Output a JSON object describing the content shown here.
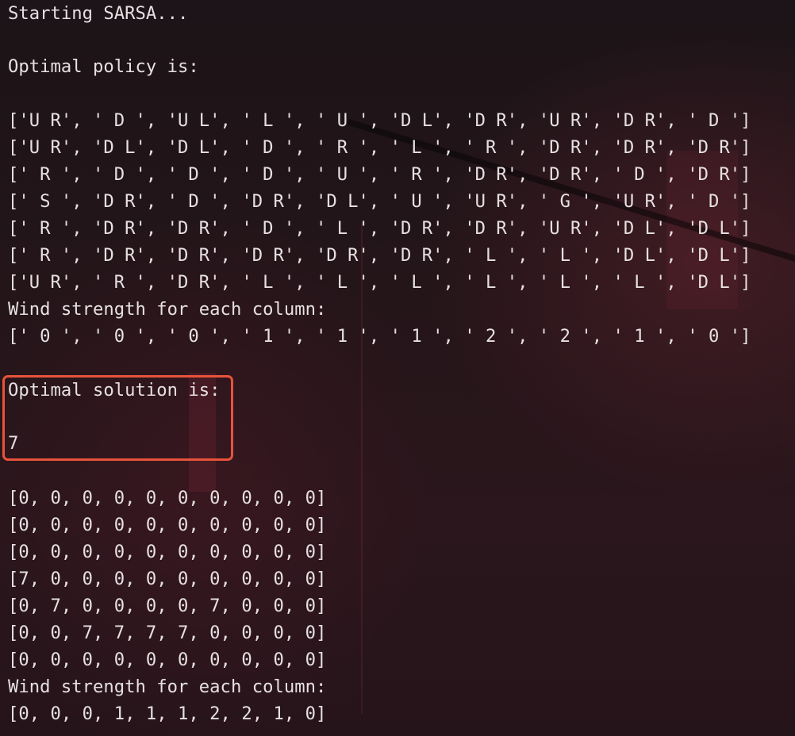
{
  "header": {
    "start_message": "Starting SARSA...",
    "policy_heading": "Optimal policy is:"
  },
  "policy_grid": [
    "['U R', ' D ', 'U L', ' L ', ' U ', 'D L', 'D R', 'U R', 'D R', ' D ']",
    "['U R', 'D L', 'D L', ' D ', ' R ', ' L ', ' R ', 'D R', 'D R', 'D R']",
    "[' R ', ' D ', ' D ', ' D ', ' U ', ' R ', 'D R', 'D R', ' D ', 'D R']",
    "[' S ', 'D R', ' D ', 'D R', 'D L', ' U ', 'U R', ' G ', 'U R', ' D ']",
    "[' R ', 'D R', 'D R', ' D ', ' L ', 'D R', 'D R', 'U R', 'D L', 'D L']",
    "[' R ', 'D R', 'D R', 'D R', 'D R', 'D R', ' L ', ' L ', 'D L', 'D L']",
    "['U R', ' R ', 'D R', ' L ', ' L ', ' L ', ' L ', ' L ', ' L ', 'D L']"
  ],
  "policy_wind": {
    "heading": "Wind strength for each column:",
    "values": "[' 0 ', ' 0 ', ' 0 ', ' 1 ', ' 1 ', ' 1 ', ' 2 ', ' 2 ', ' 1 ', ' 0 ']"
  },
  "solution": {
    "heading": "Optimal solution is:",
    "value": "7",
    "highlight_color": "#e8533b"
  },
  "solution_grid": [
    "[0, 0, 0, 0, 0, 0, 0, 0, 0, 0]",
    "[0, 0, 0, 0, 0, 0, 0, 0, 0, 0]",
    "[0, 0, 0, 0, 0, 0, 0, 0, 0, 0]",
    "[7, 0, 0, 0, 0, 0, 0, 0, 0, 0]",
    "[0, 7, 0, 0, 0, 0, 7, 0, 0, 0]",
    "[0, 0, 7, 7, 7, 7, 0, 0, 0, 0]",
    "[0, 0, 0, 0, 0, 0, 0, 0, 0, 0]"
  ],
  "solution_wind": {
    "heading": "Wind strength for each column:",
    "values": "[0, 0, 0, 1, 1, 1, 2, 2, 1, 0]"
  }
}
